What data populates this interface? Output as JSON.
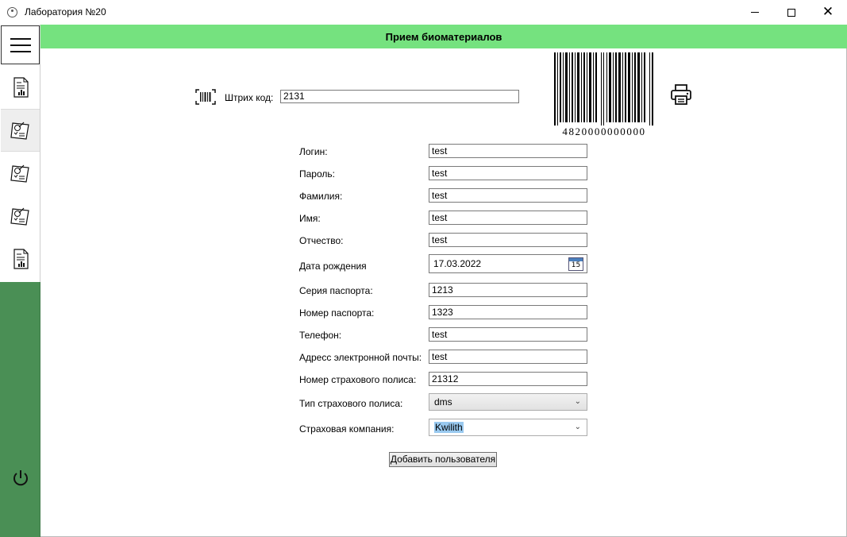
{
  "window": {
    "title": "Лаборатория №20"
  },
  "sidebar": {
    "items": [
      {
        "icon": "report-chart-icon"
      },
      {
        "icon": "checklist-icon"
      },
      {
        "icon": "checklist-icon"
      },
      {
        "icon": "checklist-icon"
      },
      {
        "icon": "report-chart-icon"
      }
    ]
  },
  "header": {
    "title": "Прием биоматериалов"
  },
  "barcode": {
    "label": "Штрих код:",
    "value": "2131",
    "digits": "4820000000000"
  },
  "form": {
    "login": {
      "label": "Логин:",
      "value": "test"
    },
    "password": {
      "label": "Пароль:",
      "value": "test"
    },
    "surname": {
      "label": "Фамилия:",
      "value": "test"
    },
    "name": {
      "label": "Имя:",
      "value": "test"
    },
    "patronymic": {
      "label": "Отчество:",
      "value": "test"
    },
    "birthdate": {
      "label": "Дата рождения",
      "value": "17.03.2022",
      "calendar_day": "15"
    },
    "passport_series": {
      "label": "Серия паспорта:",
      "value": "1213"
    },
    "passport_number": {
      "label": "Номер паспорта:",
      "value": "1323"
    },
    "phone": {
      "label": "Телефон:",
      "value": "test"
    },
    "email": {
      "label": "Адресс электронной почты:",
      "value": "test"
    },
    "policy_number": {
      "label": "Номер страхового полиса:",
      "value": "21312"
    },
    "policy_type": {
      "label": "Тип страхового полиса:",
      "value": "dms"
    },
    "insurance_company": {
      "label": "Страховая компания:",
      "value": "Kwilith"
    }
  },
  "actions": {
    "add_user": "Добавить пользователя"
  },
  "colors": {
    "header": "#75e27f",
    "sidebar": "#4a8f55",
    "selection": "#99c9ef"
  }
}
